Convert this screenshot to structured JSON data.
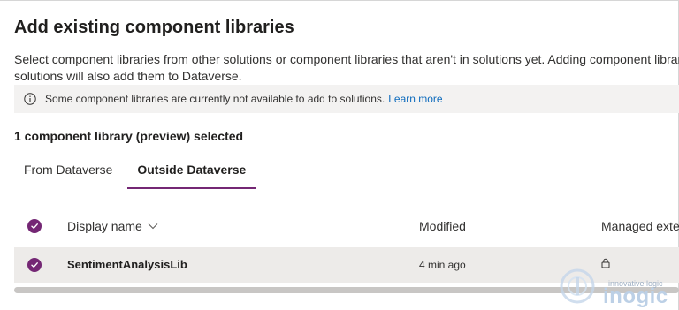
{
  "dialog": {
    "title": "Add existing component libraries",
    "description": "Select component libraries from other solutions or component libraries that aren't in solutions yet. Adding component libraries to solutions will also add them to Dataverse.",
    "info": {
      "icon": "info-icon",
      "text": "Some component libraries are currently not available to add to solutions.",
      "link": "Learn more"
    },
    "selection_summary": "1 component library (preview) selected"
  },
  "tabs": [
    {
      "label": "From Dataverse",
      "active": false
    },
    {
      "label": "Outside Dataverse",
      "active": true
    }
  ],
  "grid": {
    "columns": {
      "display_name": "Display name",
      "modified": "Modified",
      "managed": "Managed exte"
    },
    "rows": [
      {
        "display_name": "SentimentAnalysisLib",
        "modified": "4 min ago",
        "managed_icon": "lock-icon",
        "selected": true
      }
    ]
  },
  "watermark": {
    "tagline": "innovative logic",
    "brand": "inogic"
  },
  "colors": {
    "accent": "#742774",
    "link": "#0f6cbd",
    "info_bar_bg": "#f3f2f1",
    "selected_row_bg": "#edebe9"
  }
}
